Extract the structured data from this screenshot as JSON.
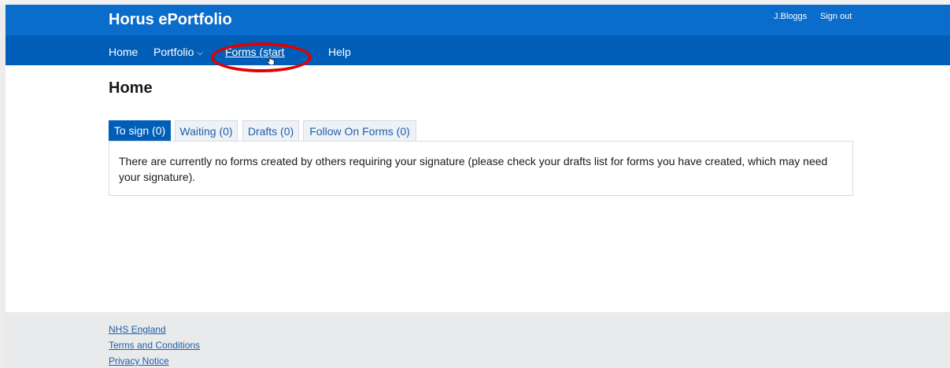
{
  "header": {
    "brand": "Horus ePortfolio",
    "user_name": "J.Bloggs",
    "sign_out": "Sign out"
  },
  "nav": {
    "home": "Home",
    "portfolio": "Portfolio",
    "portfolio_icon": "chevron-down-icon",
    "forms": "Forms (start new",
    "help": "Help"
  },
  "annotation": {
    "highlight_color": "#e00000"
  },
  "main": {
    "title": "Home",
    "tabs": [
      {
        "label": "To sign (0)",
        "active": true
      },
      {
        "label": "Waiting (0)",
        "active": false
      },
      {
        "label": "Drafts (0)",
        "active": false
      },
      {
        "label": "Follow On Forms (0)",
        "active": false
      }
    ],
    "panel_text": "There are currently no forms created by others requiring your signature (please check your drafts list for forms you have created, which may need your signature)."
  },
  "footer": {
    "links": [
      "NHS England",
      "Terms and Conditions",
      "Privacy Notice"
    ]
  },
  "colors": {
    "header_bg": "#0a6ccb",
    "nav_bg": "#005eb8",
    "link": "#1f5fa8",
    "footer_bg": "#e8eaec"
  }
}
